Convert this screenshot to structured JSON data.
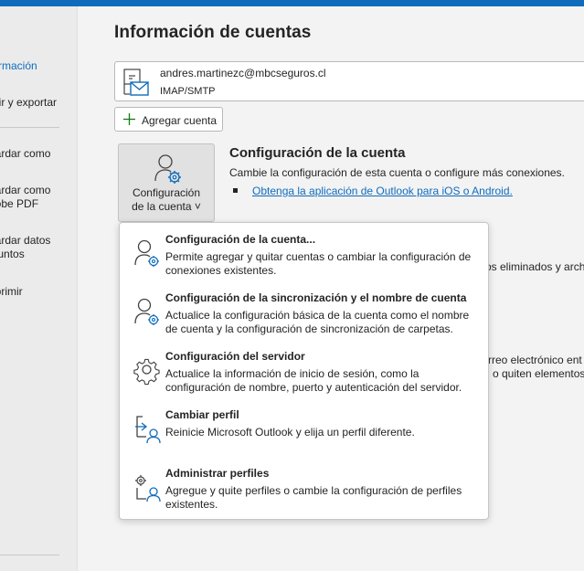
{
  "colors": {
    "accent": "#0f6cbd",
    "topbar": "#0f6cbd",
    "sidebar_bg": "#ebebeb"
  },
  "sidebar": {
    "items": [
      {
        "label": "formación",
        "active": true
      },
      {
        "label": "brir y exportar"
      },
      {
        "label": "uardar como"
      },
      {
        "label": "uardar como\ndobe PDF"
      },
      {
        "label": "uardar datos\ndjuntos"
      },
      {
        "label": "nprimir"
      }
    ]
  },
  "main": {
    "title": "Información de cuentas",
    "account": {
      "email": "andres.martinezc@mbcseguros.cl",
      "type": "IMAP/SMTP",
      "icon": "account-mail-icon"
    },
    "add_account_label": "Agregar cuenta",
    "account_settings_button": {
      "line1": "Configuración",
      "line2": "de la cuenta ˅",
      "icon": "person-gear-icon"
    },
    "section": {
      "title": "Configuración de la cuenta",
      "description": "Cambie la configuración de esta cuenta o configure más conexiones.",
      "link": "Obtenga la aplicación de Outlook para iOS o Android."
    },
    "background_snippets": [
      "os eliminados y arch",
      "rreo electrónico ent",
      "o quiten elementos"
    ]
  },
  "dropdown": {
    "items": [
      {
        "title": "Configuración de la cuenta...",
        "description": "Permite agregar y quitar cuentas o cambiar la configuración de conexiones existentes.",
        "icon": "person-gear-icon"
      },
      {
        "title": "Configuración de la sincronización y el nombre de cuenta",
        "description": "Actualice la configuración básica de la cuenta como el nombre de cuenta y la configuración de sincronización de carpetas.",
        "icon": "person-gear-icon"
      },
      {
        "title": "Configuración del servidor",
        "description": "Actualice la información de inicio de sesión, como la configuración de nombre, puerto y autenticación del servidor.",
        "icon": "gear-icon"
      },
      {
        "title": "Cambiar perfil",
        "description": "Reinicie Microsoft Outlook y elija un perfil diferente.",
        "icon": "switch-profile-icon"
      },
      {
        "title": "Administrar perfiles",
        "description": "Agregue y quite perfiles o cambie la configuración de perfiles existentes.",
        "icon": "manage-profiles-icon"
      }
    ]
  }
}
